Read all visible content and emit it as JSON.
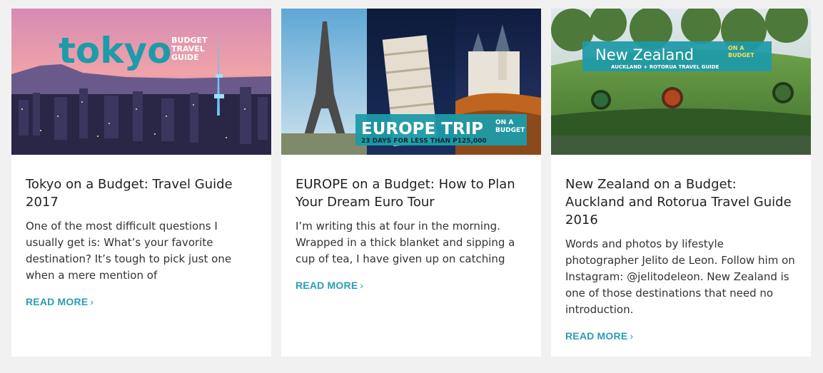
{
  "posts": [
    {
      "title": "Tokyo on a Budget: Travel Guide 2017",
      "excerpt": "One of the most difficult questions I usually get is: What’s your favorite destination? It’s tough to pick just one when a mere mention of",
      "read_more": "READ MORE",
      "image": {
        "headline": "tokyo",
        "tagline_1": "BUDGET",
        "tagline_2": "TRAVEL",
        "tagline_3": "GUIDE"
      }
    },
    {
      "title": "EUROPE on a Budget: How to Plan Your Dream Euro Tour",
      "excerpt": "I’m writing this at four in the morning. Wrapped in a thick blanket and sipping a cup of tea, I have given up on catching",
      "read_more": "READ MORE",
      "image": {
        "headline": "EUROPE TRIP",
        "tagline_1": "ON A",
        "tagline_2": "BUDGET",
        "subline": "23 DAYS FOR LESS THAN P125,000"
      }
    },
    {
      "title": "New Zealand on a Budget: Auckland and Rotorua Travel Guide 2016",
      "excerpt": "Words and photos by lifestyle photographer Jelito de Leon. Follow him on Instagram: @jelitodeleon. New Zealand is one of those destinations that need no introduction.",
      "read_more": "READ MORE",
      "image": {
        "headline": "New Zealand",
        "tagline_1": "ON A",
        "tagline_2": "BUDGET",
        "subline": "AUCKLAND + ROTORUA TRAVEL GUIDE"
      }
    }
  ],
  "icons": {
    "read_more": "chevron-right-icon"
  },
  "colors": {
    "accent": "#2a9db4",
    "banner": "#1e9aa8"
  }
}
